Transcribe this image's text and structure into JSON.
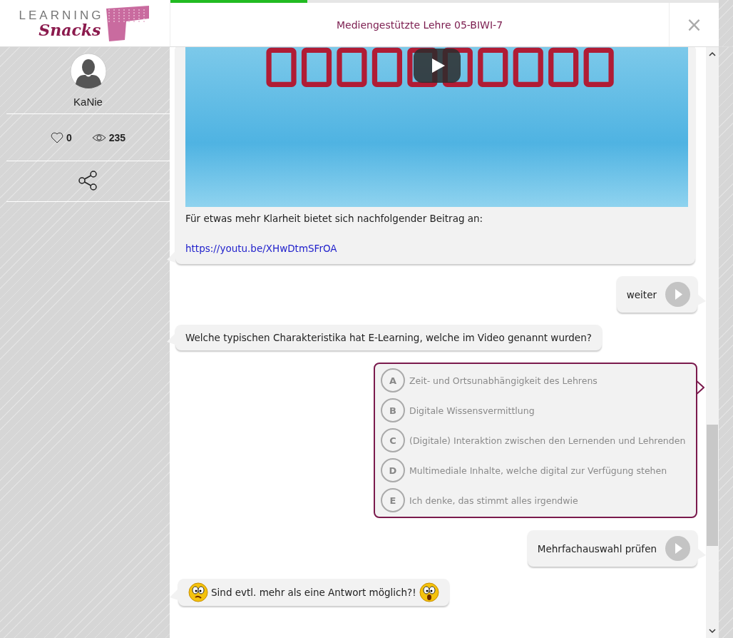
{
  "logo": {
    "line_1": "LEARNING",
    "line_2": "Snacks"
  },
  "header": {
    "title": "Mediengestützte Lehre 05-BIWI-7",
    "close": "×"
  },
  "progress": {
    "level": 0.25
  },
  "profile": {
    "name": "KaNie",
    "likes": "0",
    "views": "235"
  },
  "messages": [
    {
      "kind": "video",
      "text": "Für etwas mehr Klarheit bietet sich nachfolgender Beitrag an:",
      "link": "https://youtu.be/XHwDtmSFrOA"
    },
    {
      "kind": "action",
      "text": "weiter"
    },
    {
      "kind": "text",
      "text": "Welche typischen Charakteristika hat E-Learning, welche im Video genannt wurden?"
    },
    {
      "kind": "choices",
      "options": [
        {
          "letter": "A",
          "text": "Zeit- und Ortsunabhängigkeit des Lehrens",
          "selected": false
        },
        {
          "letter": "B",
          "text": "Digitale Wissensvermittlung",
          "selected": false
        },
        {
          "letter": "C",
          "text": "(Digitale) Interaktion zwischen den Lernenden und Lehrenden",
          "selected": false
        },
        {
          "letter": "D",
          "text": "Multimediale Inhalte, welche digital zur Verfügung stehen",
          "selected": false
        },
        {
          "letter": "E",
          "text": "Ich denke, das stimmt alles irgendwie",
          "selected": false
        }
      ]
    },
    {
      "kind": "action",
      "text": "Mehrfachauswahl prüfen"
    },
    {
      "kind": "emoji",
      "text": "Sind evtl. mehr als eine Antwort möglich?!"
    }
  ]
}
